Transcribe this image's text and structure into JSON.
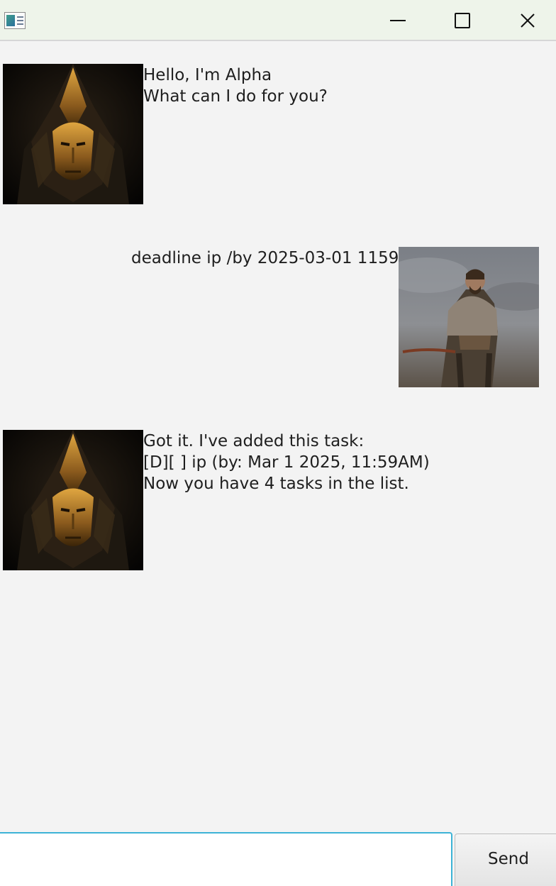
{
  "window": {
    "icon": "app-window-icon",
    "controls": {
      "minimize_icon": "minimize-icon",
      "maximize_icon": "maximize-icon",
      "close_icon": "close-icon"
    }
  },
  "dialog": {
    "messages": [
      {
        "sender": "bot",
        "avatar": "masked-warrior-avatar",
        "lines": [
          "Hello, I'm Alpha",
          "What can I do for you?"
        ]
      },
      {
        "sender": "user",
        "avatar": "fur-cloaked-warrior-avatar",
        "lines": [
          "deadline ip /by 2025-03-01 1159"
        ]
      },
      {
        "sender": "bot",
        "avatar": "masked-warrior-avatar",
        "lines": [
          "Got it. I've added this task:",
          "[D][ ] ip (by: Mar 1 2025, 11:59AM)",
          "Now you have 4 tasks in the list."
        ]
      }
    ]
  },
  "input": {
    "value": "",
    "placeholder": ""
  },
  "send_label": "Send",
  "colors": {
    "background": "#f3f3f3",
    "titlebar": "#eef4ea",
    "input_focus_border": "#3db3d6",
    "text": "#1e1e1e"
  }
}
